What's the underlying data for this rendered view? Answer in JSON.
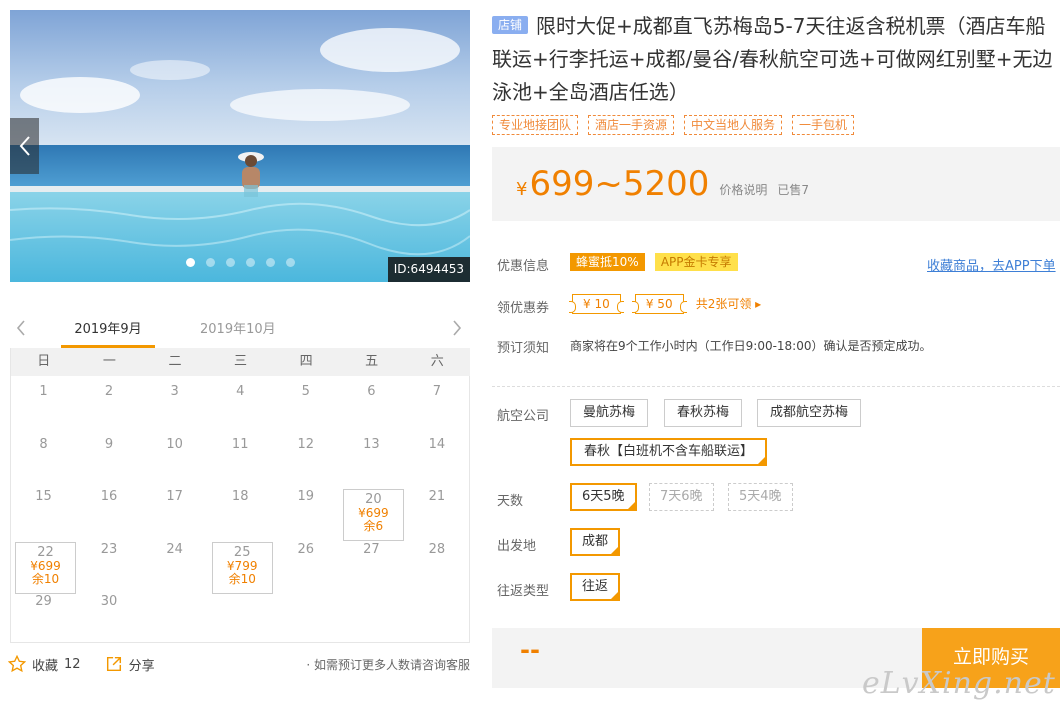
{
  "gallery": {
    "image_id": "ID:6494453",
    "dot_count": 6,
    "active_dot": 0
  },
  "calendar": {
    "months": [
      "2019年9月",
      "2019年10月"
    ],
    "weekdays": [
      "日",
      "一",
      "二",
      "三",
      "四",
      "五",
      "六"
    ],
    "days": [
      {
        "d": "1"
      },
      {
        "d": "2"
      },
      {
        "d": "3"
      },
      {
        "d": "4"
      },
      {
        "d": "5"
      },
      {
        "d": "6"
      },
      {
        "d": "7"
      },
      {
        "d": "8"
      },
      {
        "d": "9"
      },
      {
        "d": "10"
      },
      {
        "d": "11"
      },
      {
        "d": "12"
      },
      {
        "d": "13"
      },
      {
        "d": "14"
      },
      {
        "d": "15"
      },
      {
        "d": "16"
      },
      {
        "d": "17"
      },
      {
        "d": "18"
      },
      {
        "d": "19"
      },
      {
        "d": "20",
        "price": "¥699",
        "stock": "余6"
      },
      {
        "d": "21"
      },
      {
        "d": "22",
        "price": "¥699",
        "stock": "余10"
      },
      {
        "d": "23"
      },
      {
        "d": "24"
      },
      {
        "d": "25",
        "price": "¥799",
        "stock": "余10"
      },
      {
        "d": "26"
      },
      {
        "d": "27"
      },
      {
        "d": "28"
      },
      {
        "d": "29"
      },
      {
        "d": "30"
      }
    ]
  },
  "bottom_left": {
    "favorite_label": "收藏",
    "favorite_count": "12",
    "share_label": "分享",
    "note": "· 如需预订更多人数请咨询客服"
  },
  "product": {
    "shop_badge": "店铺",
    "title": "限时大促+成都直飞苏梅岛5-7天往返含税机票（酒店车船联运+行李托运+成都/曼谷/春秋航空可选+可做网红别墅+无边泳池+全岛酒店任选）",
    "tags": [
      "专业地接团队",
      "酒店一手资源",
      "中文当地人服务",
      "一手包机"
    ],
    "currency": "¥",
    "price_range": "699~5200",
    "price_note": "价格说明",
    "sold": "已售7"
  },
  "info": {
    "discount_label": "优惠信息",
    "discount_badge1": "蜂蜜抵10%",
    "discount_badge2": "APP金卡专享",
    "fav_link": "收藏商品，去APP下单",
    "coupon_label": "领优惠券",
    "coupons": [
      "¥ 10",
      "¥ 50"
    ],
    "coupon_more": "共2张可领 ▸",
    "notice_label": "预订须知",
    "notice_text": "商家将在9个工作小时内（工作日9:00-18:00）确认是否预定成功。"
  },
  "options": {
    "airline_label": "航空公司",
    "airlines": [
      "曼航苏梅",
      "春秋苏梅",
      "成都航空苏梅",
      "春秋【白班机不含车船联运】"
    ],
    "airline_selected": 3,
    "days_label": "天数",
    "days": [
      "6天5晚",
      "7天6晚",
      "5天4晚"
    ],
    "days_selected": 0,
    "departure_label": "出发地",
    "departure": "成都",
    "trip_label": "往返类型",
    "trip": "往返"
  },
  "buy": {
    "total_placeholder": "--",
    "button": "立即购买"
  },
  "watermark": "eLvXing.net",
  "colors": {
    "accent": "#f39800",
    "price": "#f08000",
    "link": "#3e7fd6",
    "shop_badge": "#8aaef0"
  }
}
